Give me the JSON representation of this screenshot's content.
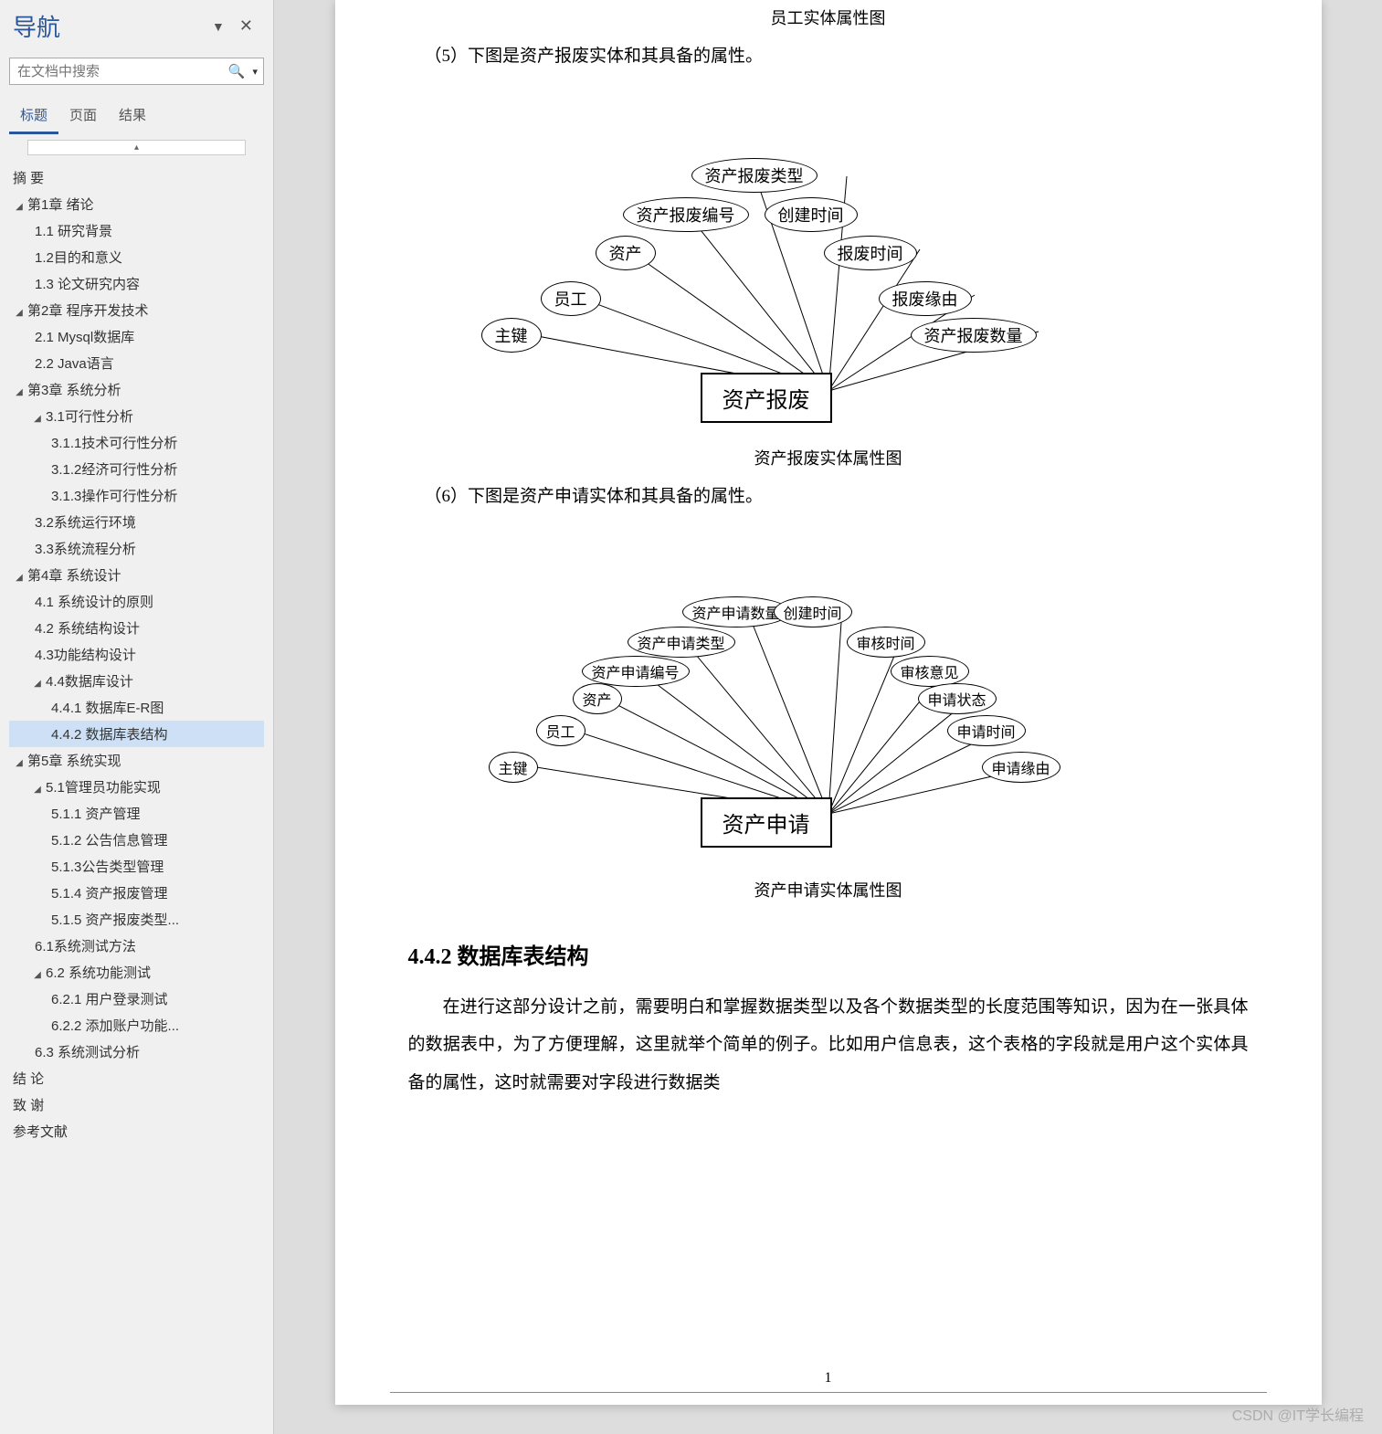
{
  "nav": {
    "title": "导航",
    "search_placeholder": "在文档中搜索",
    "tabs": {
      "headings": "标题",
      "pages": "页面",
      "results": "结果"
    },
    "collapse_glyph": "▴",
    "tree": [
      {
        "label": "摘  要",
        "lvl": "lvl-0"
      },
      {
        "label": "第1章 绪论",
        "lvl": "lvl-1",
        "toggle": true
      },
      {
        "label": "1.1 研究背景",
        "lvl": "lvl-2"
      },
      {
        "label": "1.2目的和意义",
        "lvl": "lvl-2"
      },
      {
        "label": "1.3 论文研究内容",
        "lvl": "lvl-2"
      },
      {
        "label": "第2章 程序开发技术",
        "lvl": "lvl-1",
        "toggle": true
      },
      {
        "label": "2.1 Mysql数据库",
        "lvl": "lvl-2"
      },
      {
        "label": "2.2 Java语言",
        "lvl": "lvl-2"
      },
      {
        "label": "第3章 系统分析",
        "lvl": "lvl-1",
        "toggle": true
      },
      {
        "label": "3.1可行性分析",
        "lvl": "lvl-2b",
        "toggle": true
      },
      {
        "label": "3.1.1技术可行性分析",
        "lvl": "lvl-3"
      },
      {
        "label": "3.1.2经济可行性分析",
        "lvl": "lvl-3"
      },
      {
        "label": "3.1.3操作可行性分析",
        "lvl": "lvl-3"
      },
      {
        "label": "3.2系统运行环境",
        "lvl": "lvl-2"
      },
      {
        "label": "3.3系统流程分析",
        "lvl": "lvl-2"
      },
      {
        "label": "第4章 系统设计",
        "lvl": "lvl-1",
        "toggle": true
      },
      {
        "label": "4.1 系统设计的原则",
        "lvl": "lvl-2"
      },
      {
        "label": "4.2 系统结构设计",
        "lvl": "lvl-2"
      },
      {
        "label": "4.3功能结构设计",
        "lvl": "lvl-2"
      },
      {
        "label": "4.4数据库设计",
        "lvl": "lvl-2b",
        "toggle": true
      },
      {
        "label": "4.4.1 数据库E-R图",
        "lvl": "lvl-3"
      },
      {
        "label": "4.4.2 数据库表结构",
        "lvl": "lvl-3",
        "selected": true
      },
      {
        "label": "第5章 系统实现",
        "lvl": "lvl-1",
        "toggle": true
      },
      {
        "label": "5.1管理员功能实现",
        "lvl": "lvl-2b",
        "toggle": true
      },
      {
        "label": "5.1.1 资产管理",
        "lvl": "lvl-3"
      },
      {
        "label": "5.1.2 公告信息管理",
        "lvl": "lvl-3"
      },
      {
        "label": "5.1.3公告类型管理",
        "lvl": "lvl-3"
      },
      {
        "label": "5.1.4 资产报废管理",
        "lvl": "lvl-3"
      },
      {
        "label": "5.1.5 资产报废类型...",
        "lvl": "lvl-3"
      },
      {
        "label": "6.1系统测试方法",
        "lvl": "lvl-2"
      },
      {
        "label": "6.2 系统功能测试",
        "lvl": "lvl-2b",
        "toggle": true
      },
      {
        "label": "6.2.1 用户登录测试",
        "lvl": "lvl-3"
      },
      {
        "label": "6.2.2 添加账户功能...",
        "lvl": "lvl-3"
      },
      {
        "label": "6.3 系统测试分析",
        "lvl": "lvl-2"
      },
      {
        "label": "结  论",
        "lvl": "lvl-0"
      },
      {
        "label": "致  谢",
        "lvl": "lvl-0"
      },
      {
        "label": "参考文献",
        "lvl": "lvl-0"
      }
    ]
  },
  "doc": {
    "caption1": "员工实体属性图",
    "para5": "（5）下图是资产报废实体和其具备的属性。",
    "er1": {
      "entity": "资产报废",
      "attrs": [
        "主键",
        "员工",
        "资产",
        "资产报废编号",
        "资产报废类型",
        "创建时间",
        "报废时间",
        "报废缘由",
        "资产报废数量"
      ]
    },
    "caption2": "资产报废实体属性图",
    "para6": "（6）下图是资产申请实体和其具备的属性。",
    "er2": {
      "entity": "资产申请",
      "attrs": [
        "主键",
        "员工",
        "资产",
        "资产申请编号",
        "资产申请类型",
        "资产申请数量",
        "创建时间",
        "审核时间",
        "审核意见",
        "申请状态",
        "申请时间",
        "申请缘由"
      ]
    },
    "caption3": "资产申请实体属性图",
    "section": "4.4.2  数据库表结构",
    "body": "在进行这部分设计之前，需要明白和掌握数据类型以及各个数据类型的长度范围等知识，因为在一张具体的数据表中，为了方便理解，这里就举个简单的例子。比如用户信息表，这个表格的字段就是用户这个实体具备的属性，这时就需要对字段进行数据类",
    "page_num": "1"
  },
  "watermark": "CSDN @IT学长编程"
}
